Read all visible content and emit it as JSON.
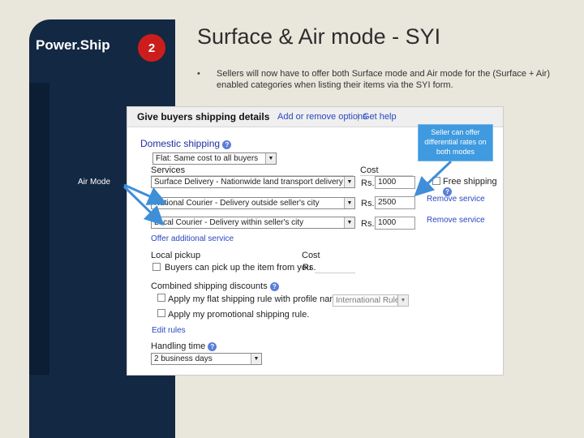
{
  "slide": {
    "brand": "Power.Ship",
    "number": "2",
    "title": "Surface & Air mode - SYI",
    "bullet_marker": "•",
    "bullet_text": "Sellers will now have to offer both Surface mode and Air mode for the (Surface + Air) enabled categories when listing their items via the SYI form.",
    "air_mode_label": "Air Mode",
    "callout": "Seller can offer differential rates on both modes"
  },
  "form": {
    "title": "Give buyers shipping details",
    "link_add_remove": "Add or remove options",
    "link_sep": "|",
    "link_help": "Get help",
    "domestic": {
      "heading": "Domestic shipping",
      "type_value": "Flat: Same cost to all buyers",
      "services_label": "Services",
      "cost_label": "Cost",
      "rows": [
        {
          "service": "Surface Delivery - Nationwide land transport delivery",
          "currency": "Rs.",
          "cost": "1000",
          "extra": "Free shipping"
        },
        {
          "service": "National Courier - Delivery outside seller's city",
          "currency": "Rs.",
          "cost": "2500",
          "extra": "Remove service"
        },
        {
          "service": "Local Courier - Delivery within seller's city",
          "currency": "Rs.",
          "cost": "1000",
          "extra": "Remove service"
        }
      ],
      "offer_more": "Offer additional service"
    },
    "local_pickup": {
      "heading": "Local pickup",
      "cost_label": "Cost",
      "option": "Buyers can pick up the item from you",
      "currency": "Rs."
    },
    "discounts": {
      "heading": "Combined shipping discounts",
      "opt1": "Apply my flat shipping rule with profile name:",
      "profile_value": "International Rule",
      "opt2": "Apply my promotional shipping rule.",
      "edit": "Edit rules"
    },
    "handling": {
      "heading": "Handling time",
      "value": "2 business days"
    }
  },
  "colors": {
    "panel": "#132843",
    "badge": "#cc1d1d",
    "callout": "#3f9adf",
    "link": "#2a46c1",
    "arrow": "#3f8ed8"
  }
}
